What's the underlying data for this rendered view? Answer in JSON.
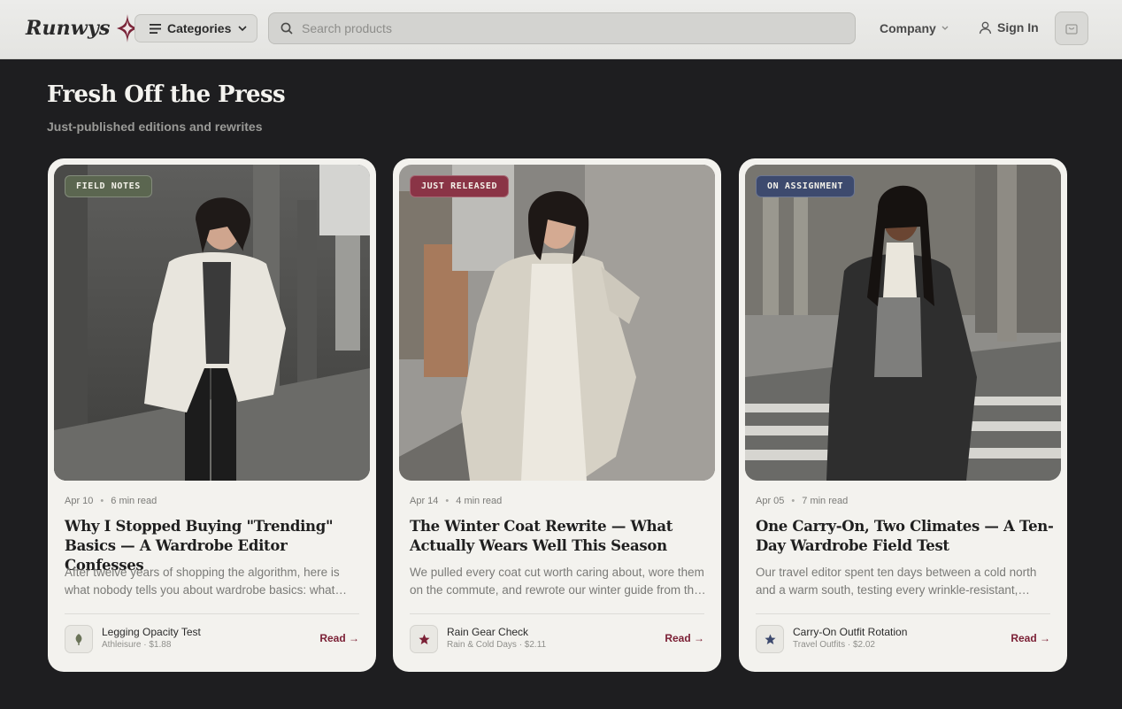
{
  "header": {
    "logo_text": "Runwys",
    "categories_label": "Categories",
    "search_placeholder": "Search products",
    "company_label": "Company",
    "signin_label": "Sign In"
  },
  "section": {
    "title": "Fresh Off the Press",
    "subtitle": "Just-published editions and rewrites"
  },
  "cards": [
    {
      "badge": "FIELD NOTES",
      "badge_color": "#5b6650",
      "date": "Apr 10",
      "read_time": "6 min read",
      "title": "Why I Stopped Buying \"Trending\" Basics — A Wardrobe Editor Confesses",
      "excerpt": "After twelve years of shopping the algorithm, here is what nobody tells you about wardrobe basics: what actually lasts and what quietly falls apart.",
      "product_icon": "leaf-icon",
      "product_icon_color": "#6a7358",
      "product_name": "Legging Opacity Test",
      "product_sub": "Athleisure · $1.88",
      "read_label": "Read →"
    },
    {
      "badge": "JUST RELEASED",
      "badge_color": "#8a3446",
      "date": "Apr 14",
      "read_time": "4 min read",
      "title": "The Winter Coat Rewrite — What Actually Wears Well This Season",
      "excerpt": "We pulled every coat cut worth caring about, wore them on the commute, and rewrote our winter guide from the ground up.",
      "product_icon": "star-icon",
      "product_icon_color": "#7b2035",
      "product_name": "Rain Gear Check",
      "product_sub": "Rain & Cold Days · $2.11",
      "read_label": "Read →"
    },
    {
      "badge": "ON ASSIGNMENT",
      "badge_color": "#3d4a6e",
      "date": "Apr 05",
      "read_time": "7 min read",
      "title": "One Carry-On, Two Climates — A Ten-Day Wardrobe Field Test",
      "excerpt": "Our travel editor spent ten days between a cold north and a warm south, testing every wrinkle-resistant, packable layer she could find.",
      "product_icon": "star-icon",
      "product_icon_color": "#3d4a6e",
      "product_name": "Carry-On Outfit Rotation",
      "product_sub": "Travel Outfits · $2.02",
      "read_label": "Read →"
    }
  ]
}
